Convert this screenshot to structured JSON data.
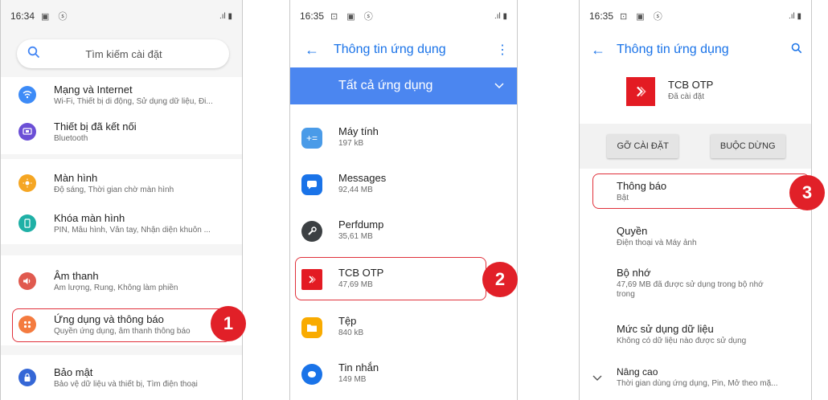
{
  "screen1": {
    "time": "16:34",
    "status_icons": "▣ ⓢ",
    "signal": ".ıl ▮",
    "search_placeholder": "Tìm kiếm cài đặt",
    "items": [
      {
        "title": "Mạng và Internet",
        "subtitle": "Wi-Fi, Thiết bị di động, Sử dụng dữ liệu, Đi...",
        "icon": "wifi-icon",
        "color": "#3d8bf7"
      },
      {
        "title": "Thiết bị đã kết nối",
        "subtitle": "Bluetooth",
        "icon": "devices-icon",
        "color": "#6b4fd6"
      },
      {
        "title": "Màn hình",
        "subtitle": "Độ sáng, Thời gian chờ màn hình",
        "icon": "brightness-icon",
        "color": "#f5a623"
      },
      {
        "title": "Khóa màn hình",
        "subtitle": "PIN, Mẫu hình, Vân tay, Nhận diện khuôn ...",
        "icon": "lock-screen-icon",
        "color": "#1fb0a6"
      },
      {
        "title": "Âm thanh",
        "subtitle": "Âm lượng, Rung, Không làm phiền",
        "icon": "sound-icon",
        "color": "#e05a4f"
      },
      {
        "title": "Ứng dụng và thông báo",
        "subtitle": "Quyền ứng dụng, âm thanh thông báo",
        "icon": "apps-icon",
        "color": "#f47b3f"
      },
      {
        "title": "Bảo mật",
        "subtitle": "Bảo vệ dữ liệu và thiết bị, Tìm điện thoại",
        "icon": "security-icon",
        "color": "#3567d6"
      }
    ],
    "step": "1"
  },
  "screen2": {
    "time": "16:35",
    "status_icons": "⊡ ▣ ⓢ",
    "signal": ".ıl ▮",
    "title": "Thông tin ứng dụng",
    "filter": "Tất cả ứng dụng",
    "apps": [
      {
        "name": "Máy tính",
        "size": "197 kB",
        "icon": "calculator-icon",
        "color": "#4a9be8"
      },
      {
        "name": "Messages",
        "size": "92,44 MB",
        "icon": "messages-icon",
        "color": "#1a73e8"
      },
      {
        "name": "Perfdump",
        "size": "35,61 MB",
        "icon": "perfdump-icon",
        "color": "#3c4043"
      },
      {
        "name": "TCB OTP",
        "size": "47,69 MB",
        "icon": "tcb-otp-icon",
        "color": "#e31b23"
      },
      {
        "name": "Tệp",
        "size": "840 kB",
        "icon": "files-icon",
        "color": "#f9ab00"
      },
      {
        "name": "Tin nhắn",
        "size": "149 MB",
        "icon": "sms-icon",
        "color": "#1a73e8"
      }
    ],
    "step": "2"
  },
  "screen3": {
    "time": "16:35",
    "status_icons": "⊡ ▣ ⓢ",
    "signal": ".ıl ▮",
    "title": "Thông tin ứng dụng",
    "app_name": "TCB OTP",
    "app_status": "Đã cài đặt",
    "uninstall": "GỠ CÀI ĐẶT",
    "force_stop": "BUỘC DỪNG",
    "rows": [
      {
        "title": "Thông báo",
        "subtitle": "Bật"
      },
      {
        "title": "Quyền",
        "subtitle": "Điện thoại và Máy ảnh"
      },
      {
        "title": "Bộ nhớ",
        "subtitle": "47,69 MB đã được sử dụng trong bộ nhớ trong"
      },
      {
        "title": "Mức sử dụng dữ liệu",
        "subtitle": "Không có dữ liệu nào được sử dụng"
      },
      {
        "title": "Nâng cao",
        "subtitle": "Thời gian dùng ứng dụng, Pin, Mở theo mặ..."
      }
    ],
    "step": "3"
  },
  "colors": {
    "accent": "#1a73e8",
    "filter_bar": "#4b86f0",
    "highlight": "#e0303a",
    "badge": "#e12028"
  }
}
